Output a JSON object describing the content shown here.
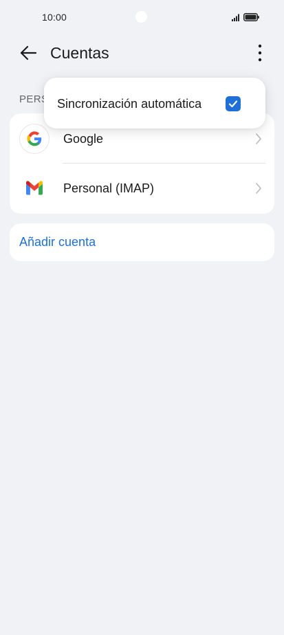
{
  "status_bar": {
    "time": "10:00",
    "icons": [
      "signal-icon",
      "battery-icon"
    ]
  },
  "header": {
    "title": "Cuentas",
    "back_icon": "back-arrow-icon",
    "more_icon": "more-vert-icon"
  },
  "section": {
    "label": "PERS"
  },
  "accounts": [
    {
      "label": "Google",
      "icon": "google-icon"
    },
    {
      "label": "Personal (IMAP)",
      "icon": "gmail-icon"
    }
  ],
  "add_account": {
    "label": "Añadir cuenta"
  },
  "popup": {
    "item_label": "Sincronización automática",
    "checked": true
  },
  "colors": {
    "background": "#f1f2f6",
    "card": "#ffffff",
    "accent": "#1f6fd6",
    "google_blue": "#4285F4",
    "google_red": "#EA4335",
    "google_yellow": "#FBBC05",
    "google_green": "#34A853"
  }
}
